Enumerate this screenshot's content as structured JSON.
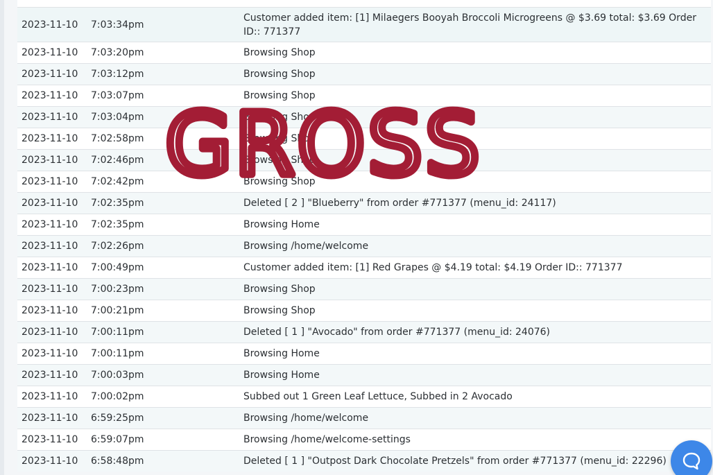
{
  "log": {
    "rows": [
      {
        "date": "",
        "time": "",
        "message": "",
        "partial": true
      },
      {
        "date": "2023-11-10",
        "time": "7:03:34pm",
        "message": "Customer added item: [1] Milaegers Booyah Broccoli Microgreens @ $3.69 total: $3.69 Order ID:: 771377",
        "tall": true
      },
      {
        "date": "2023-11-10",
        "time": "7:03:20pm",
        "message": "Browsing Shop"
      },
      {
        "date": "2023-11-10",
        "time": "7:03:12pm",
        "message": "Browsing Shop"
      },
      {
        "date": "2023-11-10",
        "time": "7:03:07pm",
        "message": "Browsing Shop"
      },
      {
        "date": "2023-11-10",
        "time": "7:03:04pm",
        "message": "Browsing Shop"
      },
      {
        "date": "2023-11-10",
        "time": "7:02:58pm",
        "message": "Browsing Shop"
      },
      {
        "date": "2023-11-10",
        "time": "7:02:46pm",
        "message": "Browsing Shop"
      },
      {
        "date": "2023-11-10",
        "time": "7:02:42pm",
        "message": "Browsing Shop"
      },
      {
        "date": "2023-11-10",
        "time": "7:02:35pm",
        "message": "Deleted [ 2 ] \"Blueberry\" from order #771377 (menu_id: 24117)"
      },
      {
        "date": "2023-11-10",
        "time": "7:02:35pm",
        "message": "Browsing Home"
      },
      {
        "date": "2023-11-10",
        "time": "7:02:26pm",
        "message": "Browsing /home/welcome"
      },
      {
        "date": "2023-11-10",
        "time": "7:00:49pm",
        "message": "Customer added item: [1] Red Grapes @ $4.19 total: $4.19 Order ID:: 771377"
      },
      {
        "date": "2023-11-10",
        "time": "7:00:23pm",
        "message": "Browsing Shop"
      },
      {
        "date": "2023-11-10",
        "time": "7:00:21pm",
        "message": "Browsing Shop"
      },
      {
        "date": "2023-11-10",
        "time": "7:00:11pm",
        "message": "Deleted [ 1 ] \"Avocado\" from order #771377 (menu_id: 24076)"
      },
      {
        "date": "2023-11-10",
        "time": "7:00:11pm",
        "message": "Browsing Home"
      },
      {
        "date": "2023-11-10",
        "time": "7:00:03pm",
        "message": "Browsing Home"
      },
      {
        "date": "2023-11-10",
        "time": "7:00:02pm",
        "message": "Subbed out 1 Green Leaf Lettuce, Subbed in 2 Avocado"
      },
      {
        "date": "2023-11-10",
        "time": "6:59:25pm",
        "message": "Browsing /home/welcome"
      },
      {
        "date": "2023-11-10",
        "time": "6:59:07pm",
        "message": "Browsing /home/welcome-settings"
      },
      {
        "date": "2023-11-10",
        "time": "6:58:48pm",
        "message": "Deleted [ 1 ] \"Outpost Dark Chocolate Pretzels\" from order #771377 (menu_id: 22296)"
      }
    ]
  },
  "overlay": {
    "stamp_text": "GROSS",
    "stamp_color": "#a31d35"
  },
  "help": {
    "icon": "chat-bubble-icon",
    "color": "#3d87e8"
  }
}
